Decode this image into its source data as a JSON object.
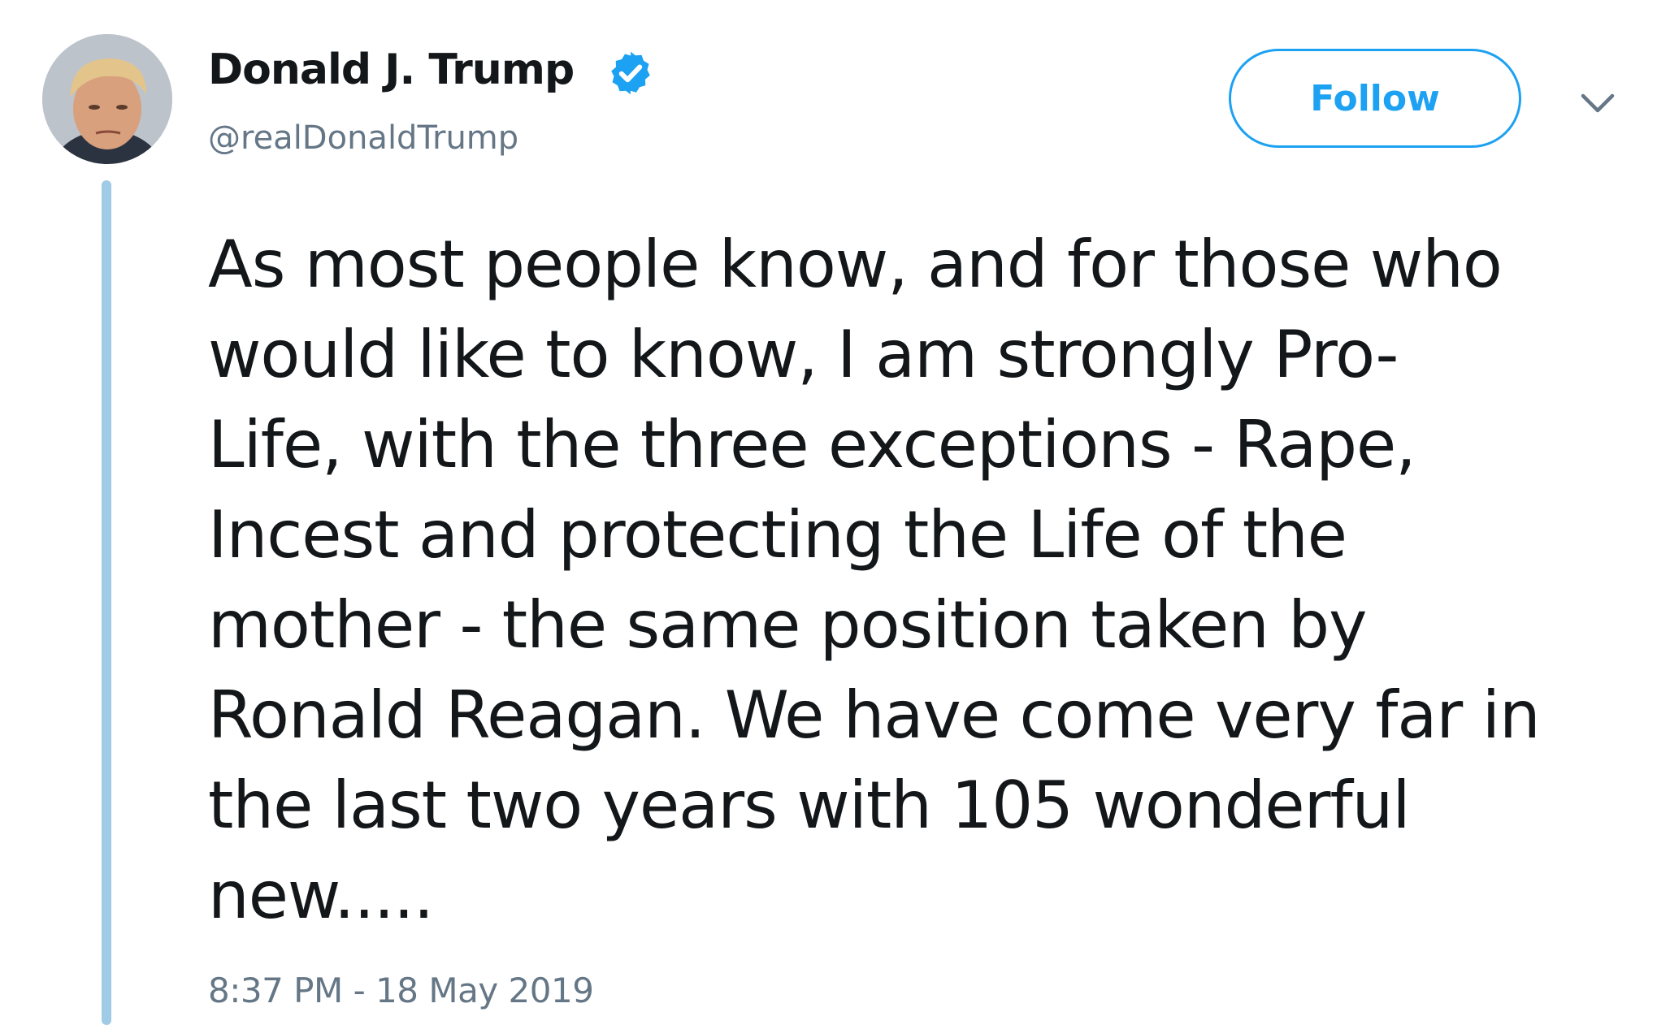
{
  "tweet": {
    "author": {
      "display_name": "Donald J. Trump",
      "handle": "@realDonaldTrump",
      "verified": true
    },
    "follow_label": "Follow",
    "text_lines": [
      "As most people know, and for those who",
      "would like to know, I am strongly Pro-",
      "Life, with the three exceptions - Rape,",
      "Incest and protecting the Life of the",
      "mother - the same position taken by",
      "Ronald Reagan. We have come very far in",
      "the last two years with 105 wonderful",
      "new....."
    ],
    "timestamp": "8:37 PM - 18 May 2019"
  },
  "colors": {
    "accent": "#1da1f2",
    "text_primary": "#14171a",
    "text_secondary": "#657786",
    "thread_line": "#9fcbe6"
  },
  "icons": {
    "verified": "verified-badge-icon",
    "menu": "chevron-down-icon"
  }
}
